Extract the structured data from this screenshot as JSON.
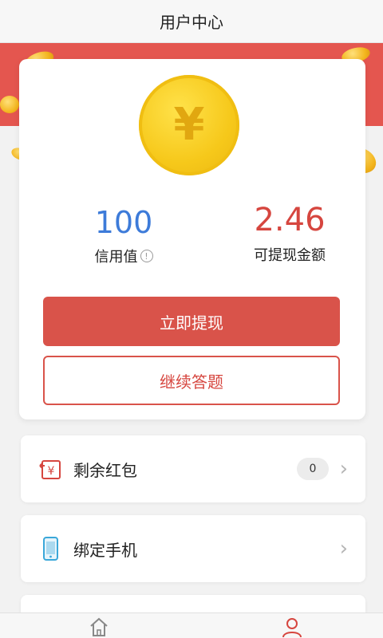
{
  "header": {
    "title": "用户中心"
  },
  "wallet": {
    "coin_symbol": "¥",
    "credit": {
      "value": "100",
      "label": "信用值",
      "info_icon": "!"
    },
    "balance": {
      "value": "2.46",
      "label": "可提现金额"
    },
    "withdraw_label": "立即提现",
    "continue_label": "继续答题"
  },
  "menu": [
    {
      "label": "剩余红包",
      "icon": "red-envelope-icon",
      "badge": "0"
    },
    {
      "label": "绑定手机",
      "icon": "phone-icon"
    }
  ],
  "tabbar": {
    "items": [
      "home-icon",
      "user-icon"
    ]
  },
  "colors": {
    "accent_red": "#d9534a",
    "credit_blue": "#3d7bd9",
    "coin_gold": "#f6c81a"
  }
}
